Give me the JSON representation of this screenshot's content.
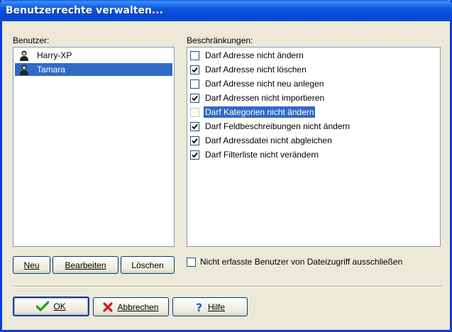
{
  "window": {
    "title": "Benutzerrechte verwalten..."
  },
  "users": {
    "label": "Benutzer:",
    "items": [
      {
        "name": "Harry-XP",
        "selected": false
      },
      {
        "name": "Tamara",
        "selected": true
      }
    ]
  },
  "restrictions": {
    "label": "Beschränkungen:",
    "items": [
      {
        "label": "Darf Adresse nicht ändern",
        "checked": false,
        "selected": false
      },
      {
        "label": "Darf Adresse nicht löschen",
        "checked": true,
        "selected": false
      },
      {
        "label": "Darf Adresse nicht neu anlegen",
        "checked": false,
        "selected": false
      },
      {
        "label": "Darf Adressen nicht importieren",
        "checked": true,
        "selected": false
      },
      {
        "label": "Darf Kategorien nicht ändern",
        "checked": false,
        "selected": true
      },
      {
        "label": "Darf Feldbeschreibungen nicht ändern",
        "checked": true,
        "selected": false
      },
      {
        "label": "Darf Adressdatei nicht abgleichen",
        "checked": true,
        "selected": false
      },
      {
        "label": "Darf Filterliste nicht verändern",
        "checked": true,
        "selected": false
      }
    ]
  },
  "user_buttons": {
    "new_label": "Neu",
    "edit_label": "Bearbeiten",
    "delete_label": "Löschen"
  },
  "exclude_option": {
    "label": "Nicht erfasste Benutzer von Dateizugriff ausschließen",
    "checked": false
  },
  "footer_buttons": {
    "ok_label": "OK",
    "cancel_label": "Abbrechen",
    "help_label": "Hilfe"
  },
  "icons": {
    "ok": "green-checkmark-icon",
    "cancel": "red-x-icon",
    "help": "blue-question-icon",
    "user": "user-silhouette-icon"
  }
}
